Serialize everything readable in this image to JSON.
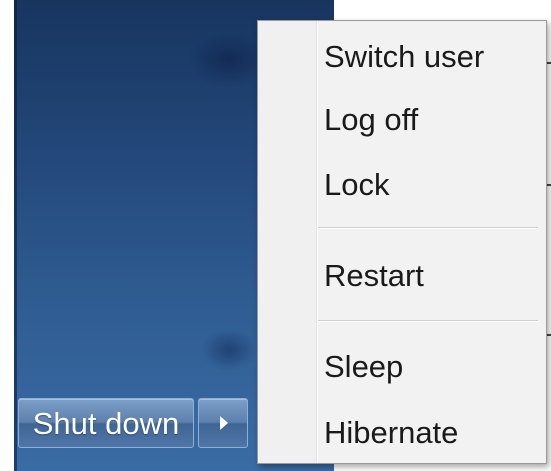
{
  "start_menu": {
    "shutdown_button_label": "Shut down",
    "arrow_icon": "triangle-right-icon"
  },
  "power_menu": {
    "items": [
      {
        "label": "Switch user"
      },
      {
        "label": "Log off"
      },
      {
        "label": "Lock"
      },
      {
        "label": "Restart"
      },
      {
        "label": "Sleep"
      },
      {
        "label": "Hibernate"
      }
    ]
  },
  "colors": {
    "panel_top": "#17355f",
    "panel_bottom": "#3a6ca4",
    "button_blue": "#5d80ad",
    "menu_bg": "#f2f2f2",
    "menu_text": "#1a1a1a"
  }
}
